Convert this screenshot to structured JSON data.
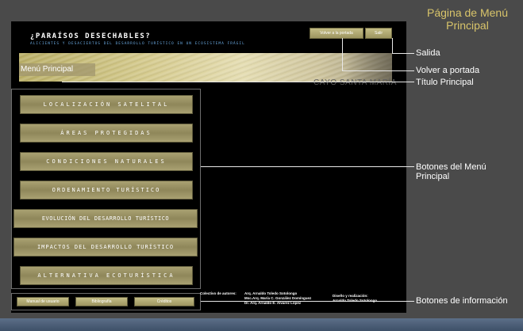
{
  "page_title": "Página de Menú Principal",
  "screen": {
    "title": "¿PARAÍSOS DESECHABLES?",
    "subtitle": "ALICIENTES Y DESACIERTOS DEL DESARROLLO TURÍSTICO EN UN ECOSISTEMA FRÁGIL",
    "top_buttons": {
      "home": "Volver a la portada",
      "exit": "Salir"
    },
    "menu_title": "Menú Principal",
    "banner_caption": "CAYO SANTA MARÍA",
    "menu_buttons": [
      "LOCALIZACIÓN SATELITAL",
      "ÁREAS PROTEGIDAS",
      "CONDICIONES NATURALES",
      "ORDENAMIENTO TURÍSTICO",
      "EVOLUCIÓN DEL DESARROLLO TURÍSTICO",
      "IMPACTOS DEL DESARROLLO TURÍSTICO",
      "ALTERNATIVA ECOTURÍSTICA"
    ],
    "info_buttons": [
      "Manual de usuario",
      "Bibliografía",
      "Créditos"
    ],
    "credits": {
      "label": "Colectivo de autores:",
      "authors": [
        "Arq. Arnaldo Toledo Sotolongo",
        "Msc.Arq. María C. González Domínguez",
        "Dr. Arq. Arnaldo E. Álvarez López"
      ],
      "design_label": "Diseño y realización:",
      "designer": "Arnaldo Toledo Sotolongo"
    }
  },
  "annotations": {
    "exit": "Salida",
    "home": "Volver a portada",
    "title": "Título Principal",
    "menu_buttons": "Botones del Menú Principal",
    "info_buttons": "Botones de información"
  },
  "colors": {
    "annotation_title": "#d8c46a",
    "button_gold": "#a9a172",
    "subtitle_blue": "#6aa9e0"
  }
}
